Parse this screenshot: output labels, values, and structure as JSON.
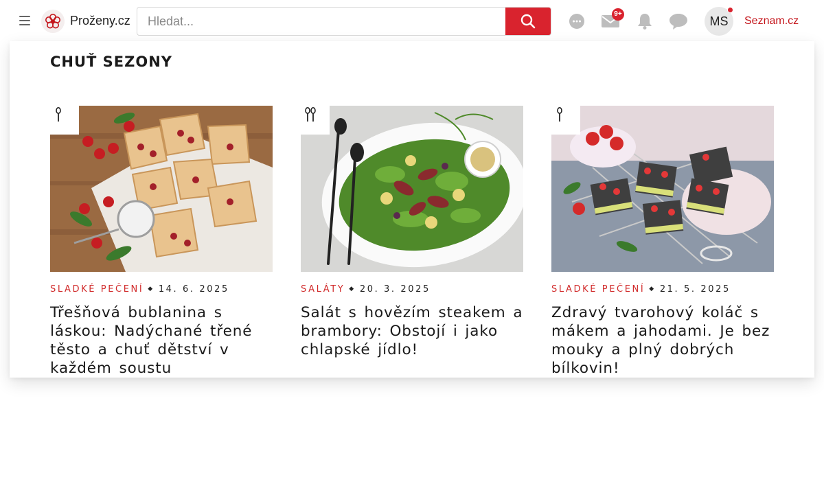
{
  "header": {
    "logo_text": "Proženy.cz",
    "search_placeholder": "Hledat...",
    "notification_badge": "9+",
    "avatar_initials": "MS",
    "seznam_link": "Seznam.cz",
    "icons": [
      "hamburger-icon",
      "flower-logo-icon",
      "search-icon",
      "chat-dots-icon",
      "mail-icon",
      "bell-icon",
      "speech-bubble-icon"
    ],
    "colors": {
      "accent": "#d9232e",
      "link": "#c4161c"
    }
  },
  "section": {
    "title": "CHUŤ SEZONY",
    "cards": [
      {
        "category": "SLADKÉ PEČENÍ",
        "date": "14. 6. 2025",
        "title": "Třešňová bublanina s láskou: Nadýchané třené těsto a chuť dětství v každém soustu",
        "tag_icon": "spoon-icon"
      },
      {
        "category": "SALÁTY",
        "date": "20. 3. 2025",
        "title": "Salát s hovězím steakem a brambory: Obstojí i jako chlapské jídlo!",
        "tag_icon": "cutlery-icon"
      },
      {
        "category": "SLADKÉ PEČENÍ",
        "date": "21. 5. 2025",
        "title": "Zdravý tvarohový koláč s mákem a jahodami. Je bez mouky a plný dobrých bílkovin!",
        "tag_icon": "spoon-icon"
      }
    ]
  }
}
